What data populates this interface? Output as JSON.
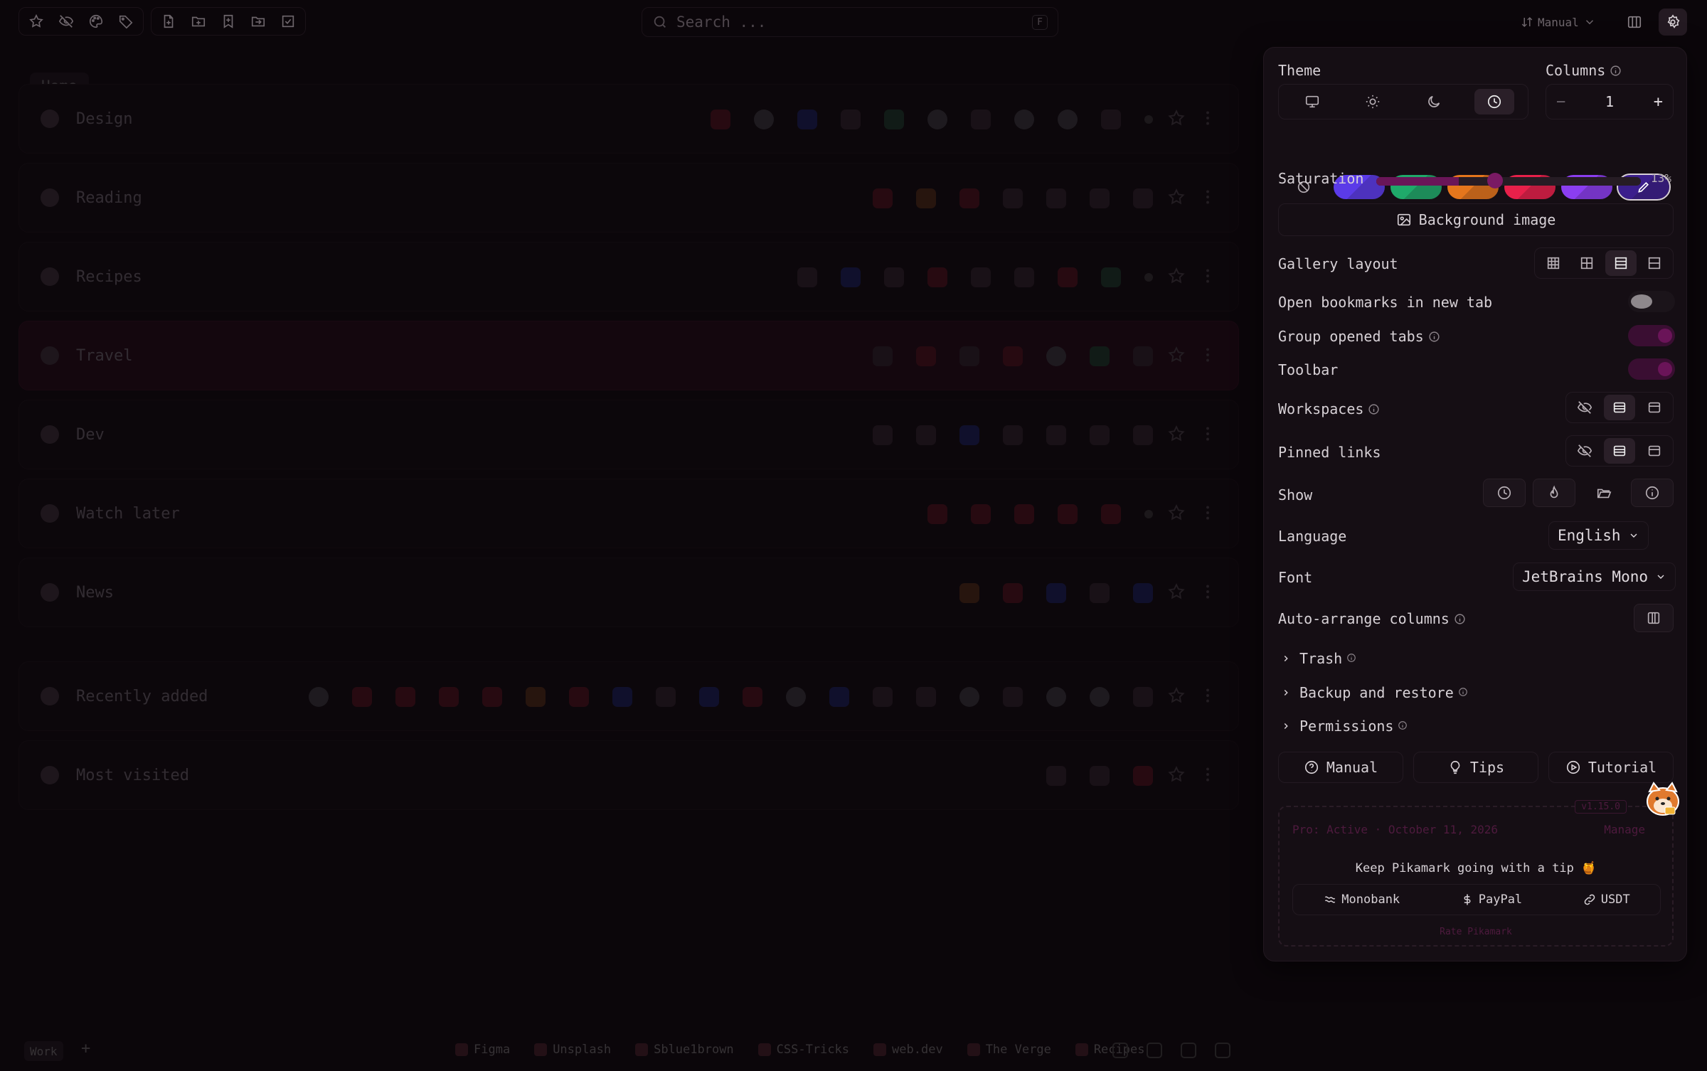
{
  "toolbar": {
    "left_icons": [
      "star-icon",
      "eye-off-icon",
      "palette-icon",
      "tag-icon"
    ],
    "mid_icons": [
      "file-plus-icon",
      "folder-plus-icon",
      "bookmark-plus-icon",
      "folder-import-icon",
      "checkbox-icon"
    ],
    "search_placeholder": "Search ...",
    "search_shortcut": "F",
    "sort_label": "Manual"
  },
  "main": {
    "home_tab": "Home",
    "rows": [
      {
        "name": "Design",
        "highlight": false
      },
      {
        "name": "Reading",
        "highlight": false
      },
      {
        "name": "Recipes",
        "highlight": false
      },
      {
        "name": "Travel",
        "highlight": true
      },
      {
        "name": "Dev",
        "highlight": false
      },
      {
        "name": "Watch later",
        "highlight": false
      },
      {
        "name": "News",
        "highlight": false
      },
      {
        "name": "Recently added",
        "highlight": false
      },
      {
        "name": "Most visited",
        "highlight": false
      }
    ]
  },
  "bottom": {
    "workspace_tab": "Work",
    "add_tab": "+",
    "pinned": [
      "Figma",
      "Unsplash",
      "Sblue1brown",
      "CSS-Tricks",
      "web.dev",
      "The Verge",
      "Recipes"
    ]
  },
  "settings": {
    "theme_label": "Theme",
    "columns_label": "Columns",
    "columns_value": "1",
    "columns_minus": "−",
    "columns_plus": "+",
    "theme_modes": [
      "monitor-icon",
      "sun-icon",
      "moon-icon",
      "clock-icon"
    ],
    "active_theme_mode": "clock-icon",
    "accent_colors": [
      "#5b3be8",
      "#1faa6a",
      "#e5761c",
      "#e8204a",
      "#8b3ef0",
      "#3b1e8c"
    ],
    "saturation_label": "Saturation",
    "saturation_value": "13%",
    "saturation_fraction": 0.13,
    "background_image_label": "Background image",
    "gallery_layout_label": "Gallery layout",
    "open_new_tab_label": "Open bookmarks in new tab",
    "open_new_tab_on": false,
    "group_tabs_label": "Group opened tabs",
    "group_tabs_on": true,
    "toolbar_label": "Toolbar",
    "toolbar_on": true,
    "workspaces_label": "Workspaces",
    "pinned_links_label": "Pinned links",
    "show_label": "Show",
    "language_label": "Language",
    "language_value": "English",
    "font_label": "Font",
    "font_value": "JetBrains Mono",
    "auto_arrange_label": "Auto-arrange columns",
    "trash_label": "Trash",
    "backup_label": "Backup and restore",
    "permissions_label": "Permissions",
    "manual_button": "Manual",
    "tips_button": "Tips",
    "tutorial_button": "Tutorial",
    "version": "v1.15.0",
    "pro_status": "Pro: Active · October 11, 2026",
    "manage_link": "Manage",
    "tip_text": "Keep Pikamark going with a tip 🍯",
    "donate_monobank": "Monobank",
    "donate_paypal": "PayPal",
    "donate_usdt": "USDT",
    "rate_link": "Rate Pikamark"
  }
}
